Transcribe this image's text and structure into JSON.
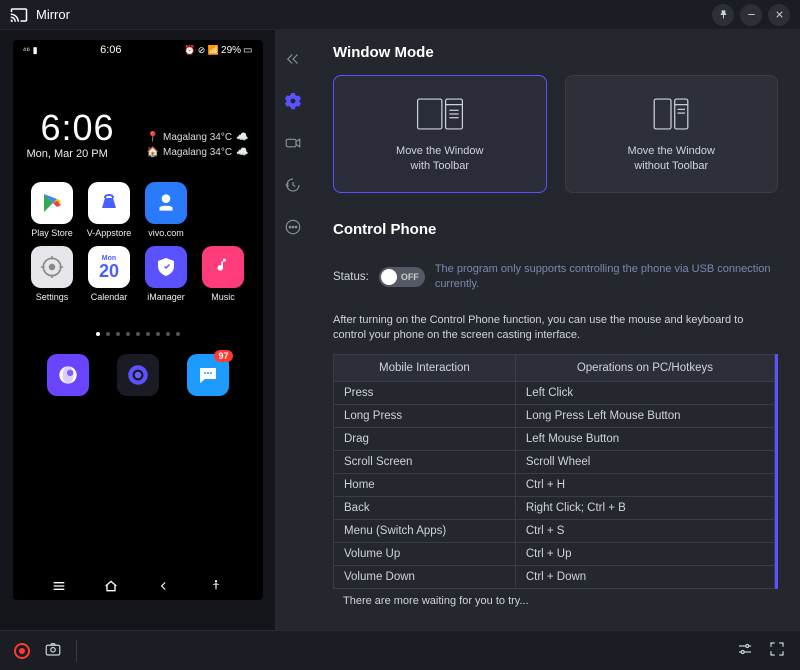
{
  "titlebar": {
    "app_name": "Mirror"
  },
  "phone": {
    "clock": "6:06",
    "battery": "29%",
    "big_time": "6:06",
    "date": "Mon, Mar 20 PM",
    "weather_loc": "Magalang 34°C",
    "weather_loc2": "Magalang 34°C",
    "apps_row1": [
      {
        "id": "playstore",
        "label": "Play Store",
        "bg": "#fff"
      },
      {
        "id": "vappstore",
        "label": "V-Appstore",
        "bg": "#fff"
      },
      {
        "id": "vivo",
        "label": "vivo.com",
        "bg": "#2a7bfc"
      }
    ],
    "apps_row2": [
      {
        "id": "settings",
        "label": "Settings",
        "bg": "#e6e6ea"
      },
      {
        "id": "calendar",
        "label": "Calendar",
        "bg": "#fff",
        "text": "20",
        "top": "Mon"
      },
      {
        "id": "imanager",
        "label": "iManager",
        "bg": "#5a52ff"
      },
      {
        "id": "music",
        "label": "Music",
        "bg": "#ff3b7a"
      }
    ],
    "dock": [
      {
        "id": "browser",
        "bg": "#6a45ff"
      },
      {
        "id": "camera",
        "bg": "#1b1b25"
      },
      {
        "id": "messages",
        "bg": "#1e9bff",
        "badge": "97"
      }
    ]
  },
  "content": {
    "window_mode_title": "Window Mode",
    "mode_with": "Move the Window\nwith Toolbar",
    "mode_without": "Move the Window\nwithout Toolbar",
    "control_title": "Control Phone",
    "status_label": "Status:",
    "toggle_text": "OFF",
    "status_desc": "The program only supports controlling the phone via USB connection currently.",
    "instructions": "After turning on the Control Phone function, you can use the mouse and keyboard to control your phone on the screen casting interface.",
    "table": {
      "head": [
        "Mobile Interaction",
        "Operations on PC/Hotkeys"
      ],
      "rows": [
        [
          "Press",
          "Left Click"
        ],
        [
          "Long Press",
          "Long Press Left Mouse Button"
        ],
        [
          "Drag",
          "Left Mouse Button"
        ],
        [
          "Scroll Screen",
          "Scroll Wheel"
        ],
        [
          "Home",
          "Ctrl + H"
        ],
        [
          "Back",
          "Right Click; Ctrl + B"
        ],
        [
          "Menu (Switch Apps)",
          "Ctrl + S"
        ],
        [
          "Volume Up",
          "Ctrl + Up"
        ],
        [
          "Volume Down",
          "Ctrl + Down"
        ]
      ]
    },
    "more": "There are more waiting for you to try..."
  }
}
